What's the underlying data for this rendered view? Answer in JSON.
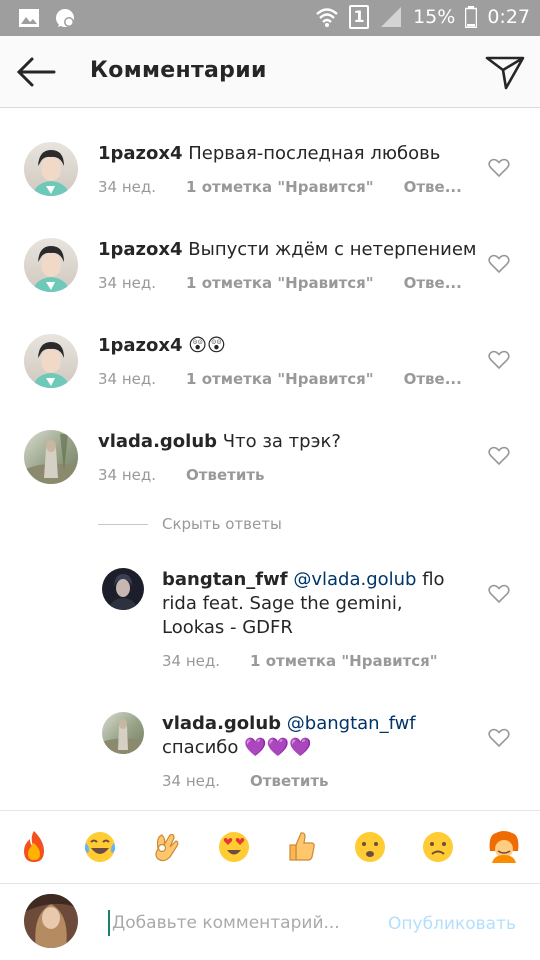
{
  "status_bar": {
    "battery": "15%",
    "time": "0:27",
    "sim": "1"
  },
  "header": {
    "title": "Комментарии"
  },
  "comments": [
    {
      "user": "1pazox4",
      "text": " Первая-последная любовь",
      "time": "34 нед.",
      "likes": "1 отметка \"Нравится\"",
      "reply": "Отве..."
    },
    {
      "user": "1pazox4",
      "text": " Выпусти ждём с нетерпением",
      "time": "34 нед.",
      "likes": "1 отметка \"Нравится\"",
      "reply": "Отве..."
    },
    {
      "user": "1pazox4",
      "text": " 😲😲",
      "time": "34 нед.",
      "likes": "1 отметка \"Нравится\"",
      "reply": "Отве..."
    },
    {
      "user": "vlada.golub",
      "text": " Что за трэк?",
      "time": "34 нед.",
      "reply": "Ответить"
    }
  ],
  "hide_replies": "Скрыть ответы",
  "replies": [
    {
      "user": "bangtan_fwf",
      "mention": "@vlada.golub",
      "line1_rest": " flo",
      "line2": "rida feat. Sage the gemini,",
      "line3": "Lookas - GDFR",
      "time": "34 нед.",
      "likes": "1 отметка \"Нравится\""
    },
    {
      "user": "vlada.golub",
      "mention": "@bangtan_fwf",
      "line2": "спасибо 💜💜💜",
      "time": "34 нед.",
      "reply": "Ответить"
    }
  ],
  "emoji_bar": [
    "🔥",
    "😂",
    "👌",
    "😍",
    "👍",
    "😦",
    "🙁",
    "🙆"
  ],
  "composer": {
    "placeholder": "Добавьте комментарий...",
    "publish": "Опубликовать"
  },
  "icons": [
    "gallery-icon",
    "whatsapp-icon",
    "wifi-icon",
    "signal-icon",
    "back-arrow-icon",
    "send-icon",
    "heart-icon"
  ],
  "colors": {
    "mention": "#003569",
    "muted": "#999999",
    "publish_disabled": "#b2dffc",
    "status_bar": "#9e9e9e"
  }
}
